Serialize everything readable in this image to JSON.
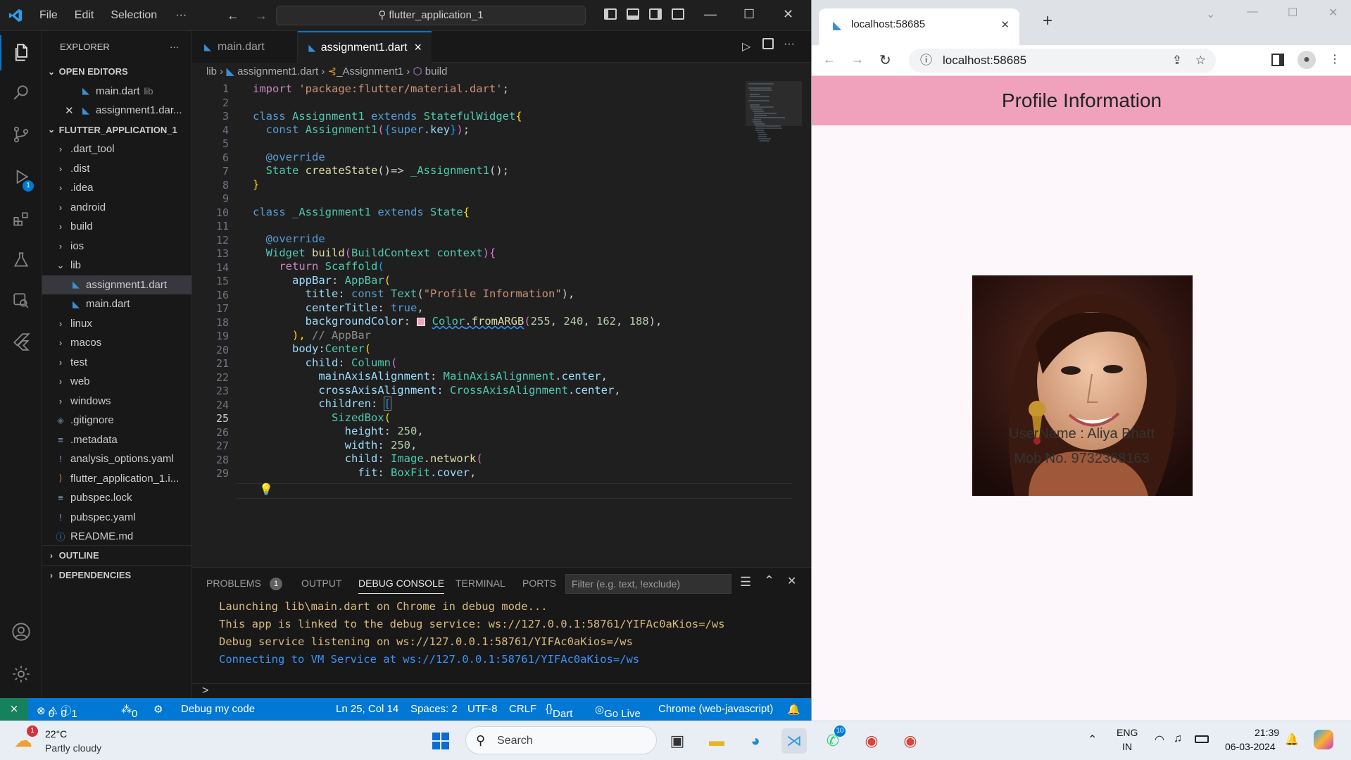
{
  "vscode": {
    "menu": [
      "File",
      "Edit",
      "Selection",
      "···"
    ],
    "command_center": "flutter_application_1",
    "explorer_title": "EXPLORER",
    "explorer_more": "···",
    "open_editors_label": "OPEN EDITORS",
    "open_editors": [
      {
        "name": "main.dart",
        "hint": "lib"
      },
      {
        "name": "assignment1.dar...",
        "hint": ""
      }
    ],
    "project_label": "FLUTTER_APPLICATION_1",
    "tree": [
      {
        "name": ".dart_tool",
        "kind": "folder",
        "depth": 1
      },
      {
        "name": ".dist",
        "kind": "folder",
        "depth": 1
      },
      {
        "name": ".idea",
        "kind": "folder",
        "depth": 1
      },
      {
        "name": "android",
        "kind": "folder",
        "depth": 1
      },
      {
        "name": "build",
        "kind": "folder",
        "depth": 1
      },
      {
        "name": "ios",
        "kind": "folder",
        "depth": 1
      },
      {
        "name": "lib",
        "kind": "folder-open",
        "depth": 1
      },
      {
        "name": "assignment1.dart",
        "kind": "dart",
        "depth": 2
      },
      {
        "name": "main.dart",
        "kind": "dart",
        "depth": 2
      },
      {
        "name": "linux",
        "kind": "folder",
        "depth": 1
      },
      {
        "name": "macos",
        "kind": "folder",
        "depth": 1
      },
      {
        "name": "test",
        "kind": "folder",
        "depth": 1
      },
      {
        "name": "web",
        "kind": "folder",
        "depth": 1
      },
      {
        "name": "windows",
        "kind": "folder",
        "depth": 1
      },
      {
        "name": ".gitignore",
        "kind": "git",
        "depth": 1
      },
      {
        "name": ".metadata",
        "kind": "lines",
        "depth": 1
      },
      {
        "name": "analysis_options.yaml",
        "kind": "yaml",
        "depth": 1
      },
      {
        "name": "flutter_application_1.i...",
        "kind": "rss",
        "depth": 1
      },
      {
        "name": "pubspec.lock",
        "kind": "lines",
        "depth": 1
      },
      {
        "name": "pubspec.yaml",
        "kind": "yaml",
        "depth": 1
      },
      {
        "name": "README.md",
        "kind": "info",
        "depth": 1
      }
    ],
    "outline_label": "OUTLINE",
    "dependencies_label": "DEPENDENCIES",
    "tabs": [
      {
        "label": "main.dart",
        "active": false
      },
      {
        "label": "assignment1.dart",
        "active": true
      }
    ],
    "tab_close": "×",
    "breadcrumb": {
      "a": "lib",
      "b": "assignment1.dart",
      "c": "_Assignment1",
      "d": "build"
    },
    "line_numbers": [
      "1",
      "2",
      "3",
      "4",
      "5",
      "6",
      "7",
      "8",
      "9",
      "10",
      "11",
      "12",
      "13",
      "14",
      "15",
      "16",
      "17",
      "18",
      "19",
      "20",
      "21",
      "22",
      "23",
      "24",
      "25",
      "26",
      "27",
      "28",
      "29"
    ],
    "code": {
      "l1_kw": "import",
      "l1_str": "'package:flutter/material.dart'",
      "l1_end": ";",
      "l3_kw": "class",
      "l3_cls": "Assignment1",
      "l3_kw2": "extends",
      "l3_cls2": "StatefulWidget",
      "l3_br": "{",
      "l4_kw": "const",
      "l4_cls": "Assignment1",
      "l4_a": "(",
      "l4_b": "{",
      "l4_kw2": "super",
      "l4_c": ".key",
      "l4_d": "}",
      "l4_e": ")",
      "l4_end": ";",
      "l6": "@override",
      "l7_a": "State ",
      "l7_fn": "createState",
      "l7_b": "()=> ",
      "l7_fn2": "_Assignment1",
      "l7_c": "();",
      "l8": "}",
      "l10_kw": "class",
      "l10_cls": "_Assignment1",
      "l10_kw2": "extends",
      "l10_cls2": "State",
      "l10_br": "{",
      "l12": "@override",
      "l13_a": "Widget ",
      "l13_fn": "build",
      "l13_b": "(",
      "l13_c": "BuildContext context",
      "l13_d": ")",
      "l13_e": "{",
      "l14_kw": "return",
      "l14_cls": "Scaffold",
      "l14_b": "(",
      "l15_prop": "appBar",
      "l15_cls": "AppBar",
      "l15_b": "(",
      "l16_prop": "title",
      "l16_kw": "const",
      "l16_cls": "Text",
      "l16_str": "\"Profile Information\"",
      "l16_e": "),",
      "l17_prop": "centerTitle",
      "l17_kw": "true",
      "l17_e": ",",
      "l18_prop": "backgroundColor",
      "l18_cls": "Color",
      "l18_fn": "fromARGB",
      "l18_n1": "255",
      "l18_n2": "240",
      "l18_n3": "162",
      "l18_n4": "188",
      "l18_e": "),",
      "l19_a": "), ",
      "l19_cmt": "// AppBar",
      "l20_prop": "body",
      "l20_cls": "Center",
      "l20_b": "(",
      "l21_prop": "child",
      "l21_cls": "Column",
      "l21_b": "(",
      "l22_prop": "mainAxisAlignment",
      "l22_cls": "MainAxisAlignment",
      "l22_c": ".center",
      "l23_prop": "crossAxisAlignment",
      "l23_cls": "CrossAxisAlignment",
      "l23_c": ".center",
      "l24_prop": "children",
      "l24_b": "[",
      "l25_cls": "SizedBox",
      "l25_b": "(",
      "l26_prop": "height",
      "l26_n": "250",
      "l27_prop": "width",
      "l27_n": "250",
      "l28_prop": "child",
      "l28_cls": "Image",
      "l28_fn": "network",
      "l28_b": "(",
      "l29_prop": "fit",
      "l29_cls": "BoxFit",
      "l29_c": ".cover"
    },
    "panel_tabs": [
      "PROBLEMS",
      "OUTPUT",
      "DEBUG CONSOLE",
      "TERMINAL",
      "PORTS"
    ],
    "problems_count": "1",
    "filter_placeholder": "Filter (e.g. text, !exclude)",
    "console": [
      "Launching lib\\main.dart on Chrome in debug mode...",
      "This app is linked to the debug service: ws://127.0.0.1:58761/YIFAc0aKios=/ws",
      "Debug service listening on ws://127.0.0.1:58761/YIFAc0aKios=/ws",
      "Connecting to VM Service at ws://127.0.0.1:58761/YIFAc0aKios=/ws"
    ],
    "console_prompt": ">",
    "status": {
      "errors": "0",
      "warnings": "0",
      "infos": "1",
      "ports": "0",
      "debug": "Debug my code",
      "position": "Ln 25, Col 14",
      "spaces": "Spaces: 2",
      "encoding": "UTF-8",
      "eol": "CRLF",
      "language": "Dart",
      "golive": "Go Live",
      "device": "Chrome (web-javascript)"
    },
    "debug_badge": "1"
  },
  "browser": {
    "tab_title": "localhost:58685",
    "url": "localhost:58685",
    "app_title": "Profile Information",
    "username": "UserName : Aliya Bhatt",
    "mobile": "Mob No. 9732368163"
  },
  "taskbar": {
    "temp": "22°C",
    "weather": "Partly cloudy",
    "weather_badge": "1",
    "search": "Search",
    "whatsapp_badge": "10",
    "lang1": "ENG",
    "lang2": "IN",
    "time": "21:39",
    "date": "06-03-2024"
  },
  "colors": {
    "accent": "#0078d4",
    "appbar": "#f0a2bc",
    "console": "#d7ba7d",
    "console_link": "#3794ff"
  }
}
